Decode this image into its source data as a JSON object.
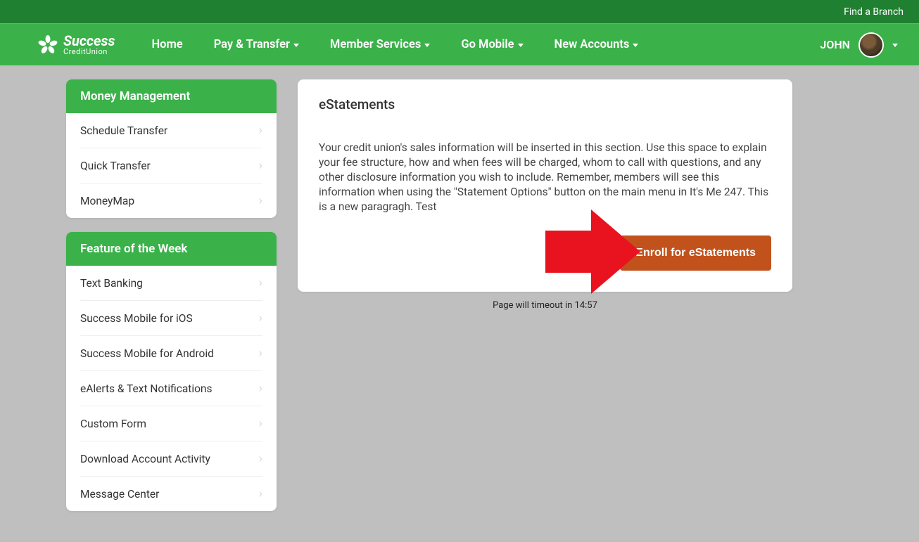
{
  "topbar": {
    "find_branch": "Find a Branch"
  },
  "logo": {
    "main": "Success",
    "sub": "CreditUnion"
  },
  "nav": {
    "items": [
      {
        "label": "Home",
        "dropdown": false
      },
      {
        "label": "Pay & Transfer",
        "dropdown": true
      },
      {
        "label": "Member Services",
        "dropdown": true
      },
      {
        "label": "Go Mobile",
        "dropdown": true
      },
      {
        "label": "New Accounts",
        "dropdown": true
      }
    ],
    "user": "JOHN"
  },
  "sidebar": {
    "money_mgmt": {
      "title": "Money Management",
      "items": [
        "Schedule Transfer",
        "Quick Transfer",
        "MoneyMap"
      ]
    },
    "feature": {
      "title": "Feature of the Week",
      "items": [
        "Text Banking",
        "Success Mobile for iOS",
        "Success Mobile for Android",
        "eAlerts & Text Notifications",
        "Custom Form",
        "Download Account Activity",
        "Message Center"
      ]
    }
  },
  "main": {
    "title": "eStatements",
    "body": "Your credit union's sales information will be inserted in this section. Use this space to explain your fee structure, how and when fees will be charged, whom to call with questions, and any other disclosure information you wish to include. Remember, members will see this information when using the \"Statement Options\" button on the main menu in It's Me 247. This is a new paragragh. Test",
    "enroll_label": "Enroll for eStatements"
  },
  "timeout": {
    "prefix": "Page will timeout in ",
    "value": "14:57"
  }
}
